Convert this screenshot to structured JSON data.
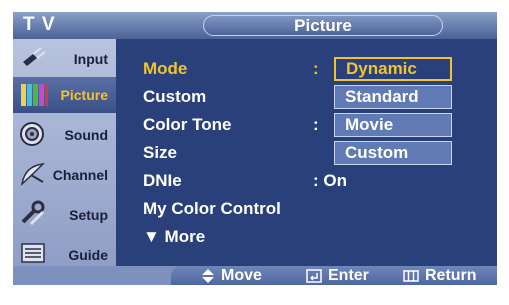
{
  "header": {
    "device_label": "T V",
    "menu_title": "Picture"
  },
  "sidebar": {
    "items": [
      {
        "label": "Input",
        "icon": "input-plug-icon",
        "active": false
      },
      {
        "label": "Picture",
        "icon": "picture-bars-icon",
        "active": true
      },
      {
        "label": "Sound",
        "icon": "speaker-icon",
        "active": false
      },
      {
        "label": "Channel",
        "icon": "satellite-dish-icon",
        "active": false
      },
      {
        "label": "Setup",
        "icon": "setup-tools-icon",
        "active": false
      },
      {
        "label": "Guide",
        "icon": "program-guide-icon",
        "active": false
      }
    ]
  },
  "menu": {
    "items": [
      {
        "label": "Mode",
        "value": ": ",
        "selected": true
      },
      {
        "label": "Custom",
        "value": ""
      },
      {
        "label": "Color Tone",
        "value": ": "
      },
      {
        "label": "Size",
        "value": ""
      },
      {
        "label": "DNIe",
        "value": ": On"
      },
      {
        "label": "My Color Control",
        "value": ""
      },
      {
        "label": "▼ More",
        "value": ""
      }
    ]
  },
  "dropdown": {
    "options": [
      "Dynamic",
      "Standard",
      "Movie",
      "Custom"
    ],
    "selected": "Dynamic"
  },
  "footer": {
    "move_label": "Move",
    "enter_label": "Enter",
    "return_label": "Return"
  },
  "colors": {
    "background": "#29407a",
    "highlight": "#f3c32d",
    "text": "#ffffff"
  }
}
